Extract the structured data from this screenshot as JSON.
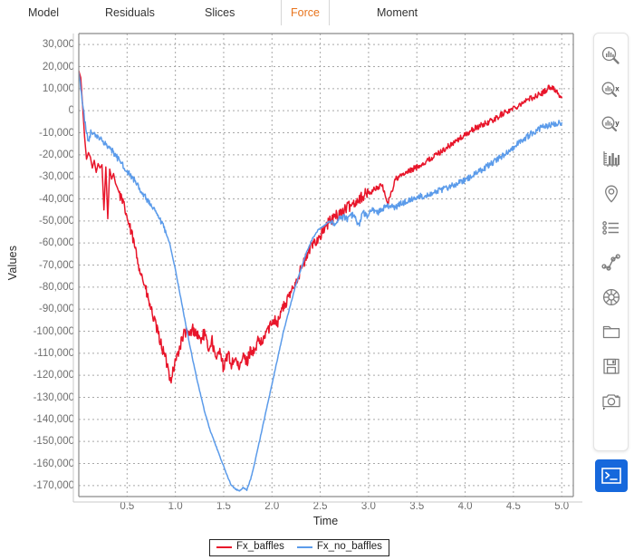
{
  "tabs": [
    {
      "label": "Model",
      "active": false
    },
    {
      "label": "Residuals",
      "active": false
    },
    {
      "label": "Slices",
      "active": false
    },
    {
      "label": "Force",
      "active": true
    },
    {
      "label": "Moment",
      "active": false
    }
  ],
  "colors": {
    "accent_active_tab": "#e8741c",
    "series_red": "#e8152a",
    "series_blue": "#5b9bea",
    "grid": "#9a9a9a",
    "axis": "#8a8a8a",
    "tick_text": "#6e6e6e",
    "terminal_button": "#1668dc",
    "toolbar_icon": "#7a7a7a"
  },
  "toolbar": {
    "buttons": [
      {
        "name": "zoom-icon",
        "title": "Zoom"
      },
      {
        "name": "zoom-x-icon",
        "title": "Zoom X",
        "badge": "x"
      },
      {
        "name": "zoom-y-icon",
        "title": "Zoom Y",
        "badge": "y"
      },
      {
        "name": "bar-chart-axes-icon",
        "title": "Axes"
      },
      {
        "name": "map-pin-icon",
        "title": "Marker"
      },
      {
        "name": "list-icon",
        "title": "Legend list"
      },
      {
        "name": "line-chart-icon",
        "title": "Series"
      },
      {
        "name": "target-icon",
        "title": "Target"
      },
      {
        "name": "folder-icon",
        "title": "Open"
      },
      {
        "name": "save-floppy-icon",
        "title": "Save"
      },
      {
        "name": "camera-icon",
        "title": "Screenshot"
      }
    ],
    "terminal": {
      "name": "terminal-icon",
      "title": "Terminal",
      "glyph": ">_"
    }
  },
  "chart_data": {
    "type": "line",
    "title": "",
    "xlabel": "Time",
    "ylabel": "Values",
    "xlim": [
      0.0,
      5.12
    ],
    "ylim": [
      -175000,
      35000
    ],
    "grid": true,
    "legend_position": "bottom-center",
    "xticks": [
      "0.5",
      "1.0",
      "1.5",
      "2.0",
      "2.5",
      "3.0",
      "3.5",
      "4.0",
      "4.5",
      "5.0"
    ],
    "xtick_values": [
      0.5,
      1.0,
      1.5,
      2.0,
      2.5,
      3.0,
      3.5,
      4.0,
      4.5,
      5.0
    ],
    "yticks": [
      "30,000",
      "20,000",
      "10,000",
      "0",
      "-10,000",
      "-20,000",
      "-30,000",
      "-40,000",
      "-50,000",
      "-60,000",
      "-70,000",
      "-80,000",
      "-90,000",
      "-100,000",
      "-110,000",
      "-120,000",
      "-130,000",
      "-140,000",
      "-150,000",
      "-160,000",
      "-170,000"
    ],
    "ytick_values": [
      30000,
      20000,
      10000,
      0,
      -10000,
      -20000,
      -30000,
      -40000,
      -50000,
      -60000,
      -70000,
      -80000,
      -90000,
      -100000,
      -110000,
      -120000,
      -130000,
      -140000,
      -150000,
      -160000,
      -170000
    ],
    "series": [
      {
        "name": "Fx_baffles",
        "color": "#e8152a",
        "x": [
          0.0,
          0.02,
          0.04,
          0.06,
          0.08,
          0.1,
          0.12,
          0.14,
          0.16,
          0.18,
          0.2,
          0.22,
          0.24,
          0.26,
          0.28,
          0.3,
          0.32,
          0.34,
          0.36,
          0.38,
          0.4,
          0.44,
          0.48,
          0.52,
          0.56,
          0.6,
          0.64,
          0.68,
          0.72,
          0.76,
          0.8,
          0.84,
          0.88,
          0.92,
          0.95,
          0.98,
          1.02,
          1.06,
          1.1,
          1.14,
          1.18,
          1.22,
          1.26,
          1.3,
          1.34,
          1.38,
          1.42,
          1.46,
          1.5,
          1.54,
          1.58,
          1.62,
          1.66,
          1.7,
          1.74,
          1.78,
          1.82,
          1.86,
          1.9,
          1.94,
          1.98,
          2.02,
          2.06,
          2.1,
          2.14,
          2.18,
          2.24,
          2.3,
          2.36,
          2.42,
          2.48,
          2.54,
          2.6,
          2.66,
          2.72,
          2.78,
          2.84,
          2.9,
          2.96,
          3.02,
          3.08,
          3.14,
          3.2,
          3.28,
          3.36,
          3.44,
          3.52,
          3.6,
          3.7,
          3.8,
          3.9,
          4.0,
          4.1,
          4.2,
          4.3,
          4.4,
          4.5,
          4.6,
          4.7,
          4.8,
          4.88,
          4.92,
          5.0
        ],
        "y": [
          18000,
          15000,
          2000,
          -12000,
          -22000,
          -19000,
          -21000,
          -26000,
          -22500,
          -28000,
          -24000,
          -26000,
          -24500,
          -45000,
          -25500,
          -49000,
          -26500,
          -31000,
          -28500,
          -33000,
          -35000,
          -40000,
          -45000,
          -52000,
          -58000,
          -66000,
          -73000,
          -79000,
          -86000,
          -92000,
          -98000,
          -104000,
          -110000,
          -116000,
          -122000,
          -117000,
          -111000,
          -105000,
          -100000,
          -102000,
          -99000,
          -101000,
          -104000,
          -101000,
          -108000,
          -104000,
          -114000,
          -107000,
          -118000,
          -110000,
          -115000,
          -112000,
          -118000,
          -111000,
          -114000,
          -108000,
          -110000,
          -104000,
          -106000,
          -100000,
          -98000,
          -94000,
          -96000,
          -90000,
          -88000,
          -84000,
          -78000,
          -72000,
          -66000,
          -60000,
          -58000,
          -54000,
          -50000,
          -48000,
          -46000,
          -44000,
          -42000,
          -40000,
          -38000,
          -37000,
          -35000,
          -34000,
          -42000,
          -31000,
          -29000,
          -27000,
          -25000,
          -23000,
          -20000,
          -17000,
          -14000,
          -11000,
          -8000,
          -6000,
          -4000,
          -1000,
          1000,
          4000,
          6000,
          8000,
          11000,
          10000,
          6000
        ]
      },
      {
        "name": "Fx_no_baffles",
        "color": "#5b9bea",
        "x": [
          0.0,
          0.02,
          0.04,
          0.06,
          0.08,
          0.1,
          0.13,
          0.16,
          0.2,
          0.24,
          0.28,
          0.32,
          0.36,
          0.4,
          0.46,
          0.52,
          0.58,
          0.64,
          0.7,
          0.76,
          0.82,
          0.88,
          0.94,
          1.0,
          1.06,
          1.12,
          1.18,
          1.24,
          1.3,
          1.36,
          1.42,
          1.48,
          1.54,
          1.58,
          1.62,
          1.66,
          1.7,
          1.74,
          1.78,
          1.82,
          1.86,
          1.9,
          1.94,
          2.0,
          2.06,
          2.12,
          2.18,
          2.24,
          2.3,
          2.36,
          2.42,
          2.48,
          2.54,
          2.6,
          2.66,
          2.72,
          2.78,
          2.84,
          2.9,
          2.94,
          2.98,
          3.04,
          3.1,
          3.16,
          3.22,
          3.28,
          3.34,
          3.4,
          3.46,
          3.52,
          3.58,
          3.64,
          3.7,
          3.76,
          3.84,
          3.92,
          4.0,
          4.1,
          4.2,
          4.3,
          4.4,
          4.5,
          4.6,
          4.7,
          4.8,
          4.9,
          5.0
        ],
        "y": [
          17000,
          10000,
          2000,
          -4000,
          -9000,
          -14000,
          -9000,
          -11000,
          -12000,
          -13500,
          -15000,
          -17000,
          -19000,
          -21500,
          -25000,
          -28500,
          -32000,
          -36000,
          -40000,
          -44000,
          -48000,
          -53000,
          -60000,
          -72000,
          -86000,
          -100000,
          -113000,
          -125000,
          -136000,
          -145000,
          -152000,
          -159000,
          -166000,
          -170000,
          -171500,
          -172500,
          -171000,
          -172000,
          -167000,
          -160000,
          -152000,
          -144000,
          -136000,
          -124000,
          -112000,
          -100000,
          -90000,
          -80000,
          -72000,
          -64000,
          -58000,
          -54000,
          -52000,
          -50000,
          -51000,
          -48000,
          -49000,
          -47000,
          -52000,
          -46000,
          -48000,
          -45000,
          -46000,
          -44000,
          -43000,
          -44000,
          -42000,
          -41000,
          -40000,
          -39000,
          -38500,
          -37500,
          -36500,
          -36000,
          -34500,
          -33000,
          -31500,
          -29000,
          -26000,
          -23000,
          -20000,
          -16500,
          -13000,
          -10000,
          -7500,
          -6000,
          -5500
        ]
      }
    ]
  }
}
